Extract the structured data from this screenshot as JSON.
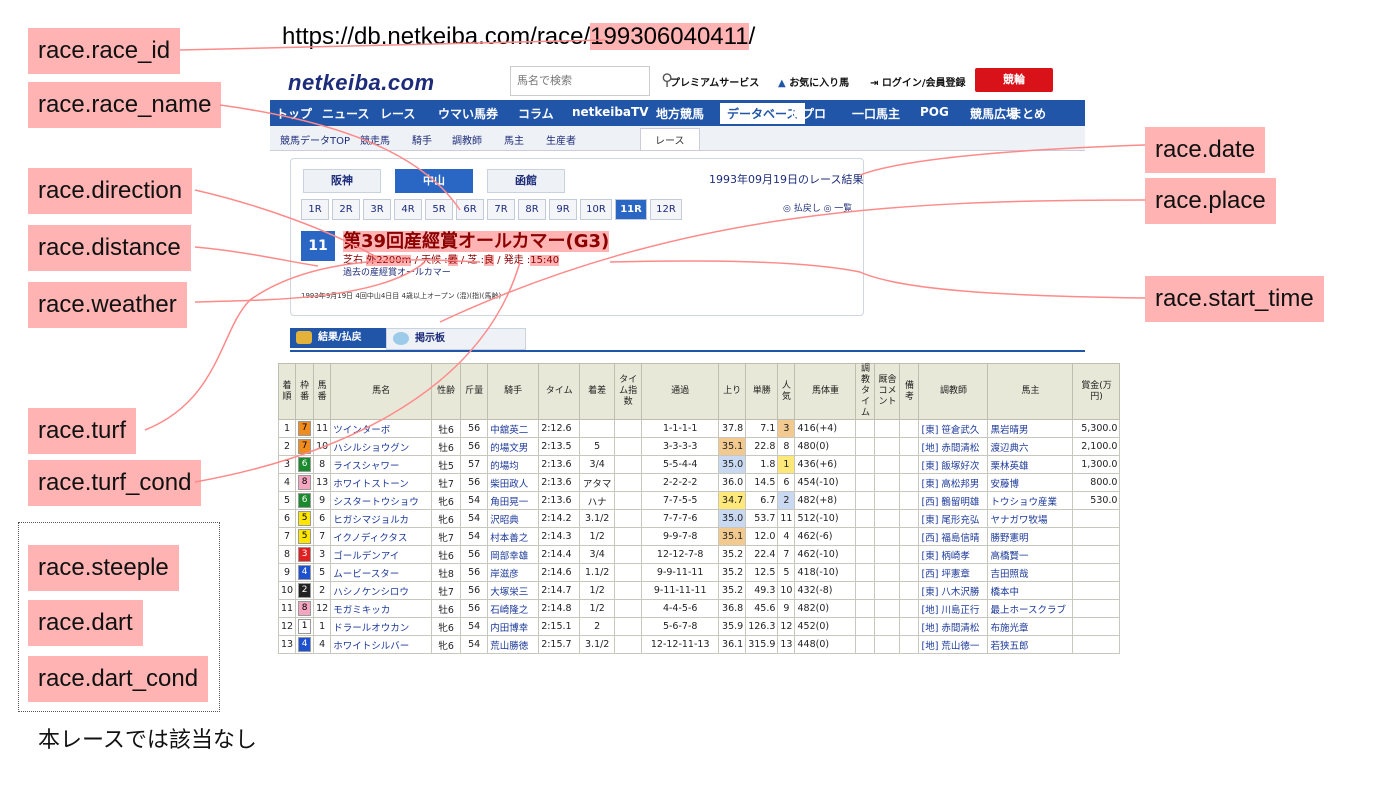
{
  "url": {
    "prefix": "https://db.netkeiba.com/race/",
    "race_id": "199306040411",
    "suffix": "/"
  },
  "annotations": {
    "race_id": "race.race_id",
    "race_name": "race.race_name",
    "direction": "race.direction",
    "distance": "race.distance",
    "weather": "race.weather",
    "turf": "race.turf",
    "turf_cond": "race.turf_cond",
    "steeple": "race.steeple",
    "dart": "race.dart",
    "dart_cond": "race.dart_cond",
    "date": "race.date",
    "place": "race.place",
    "start_time": "race.start_time"
  },
  "note": "本レースでは該当なし",
  "site": {
    "logo": "netkeiba.com",
    "search_placeholder": "馬名で検索",
    "premium": "プレミアムサービス",
    "favorite": "お気に入り馬",
    "login": "ログイン/会員登録",
    "keirin": "競輪",
    "gnav": [
      "トップ",
      "ニュース",
      "レース",
      "ウマい馬券",
      "コラム",
      "netkeibaTV",
      "地方競馬",
      "データベース",
      "俺プロ",
      "一口馬主",
      "POG",
      "競馬広場",
      "まとめ"
    ],
    "gnav_active": 7,
    "subnav": [
      "競馬データTOP",
      "競走馬",
      "騎手",
      "調教師",
      "馬主",
      "生産者",
      "レース"
    ],
    "subnav_active": 6
  },
  "race": {
    "place_tabs": [
      "阪神",
      "中山",
      "函館"
    ],
    "place_active": 1,
    "date_text": "1993年09月19日のレース結果",
    "race_numbers": [
      "1R",
      "2R",
      "3R",
      "4R",
      "5R",
      "6R",
      "7R",
      "8R",
      "9R",
      "10R",
      "11R",
      "12R"
    ],
    "race_active": 10,
    "back_link": "◎ 払戻し ◎ 一覧",
    "badge": "11 R",
    "name": "第39回産經賞オールカマー(G3)",
    "info_surface": "芝右",
    "info_direction": "外",
    "info_distance": "2200m",
    "info_weather_label": "/ 天候 :",
    "info_weather": "曇",
    "info_turf_label": "/ 芝 :",
    "info_turf_cond": "良",
    "info_start_label": "/ 発走 :",
    "info_start": "15:40",
    "past_link": "過去の産經賞オールカマー",
    "detail": "1993年9月19日 4回中山4日目 4歳以上オープン (混)(指)(馬齢)"
  },
  "tabs": [
    "結果/払戻",
    "掲示板"
  ],
  "table": {
    "headers": [
      "着順",
      "枠番",
      "馬番",
      "馬名",
      "性齢",
      "斤量",
      "騎手",
      "タイム",
      "着差",
      "タイム指数",
      "通過",
      "上り",
      "単勝",
      "人気",
      "馬体重",
      "調教タイム",
      "厩舎コメント",
      "備考",
      "調教師",
      "馬主",
      "賞金(万円)"
    ],
    "rows": [
      [
        "1",
        "7",
        "11",
        "ツインターボ",
        "牡6",
        "56",
        "中舘英二",
        "2:12.6",
        "",
        "",
        "1-1-1-1",
        "37.8",
        "7.1",
        "3",
        "416(+4)",
        "",
        "",
        "",
        "[東] 笹倉武久",
        "黒岩晴男",
        "5,300.0"
      ],
      [
        "2",
        "7",
        "10",
        "ハシルショウグン",
        "牡6",
        "56",
        "的場文男",
        "2:13.5",
        "5",
        "",
        "3-3-3-3",
        "35.1",
        "22.8",
        "8",
        "480(0)",
        "",
        "",
        "",
        "[地] 赤間清松",
        "渡辺典六",
        "2,100.0"
      ],
      [
        "3",
        "6",
        "8",
        "ライスシャワー",
        "牡5",
        "57",
        "的場均",
        "2:13.6",
        "3/4",
        "",
        "5-5-4-4",
        "35.0",
        "1.8",
        "1",
        "436(+6)",
        "",
        "",
        "",
        "[東] 飯塚好次",
        "栗林英雄",
        "1,300.0"
      ],
      [
        "4",
        "8",
        "13",
        "ホワイトストーン",
        "牡7",
        "56",
        "柴田政人",
        "2:13.6",
        "アタマ",
        "",
        "2-2-2-2",
        "36.0",
        "14.5",
        "6",
        "454(-10)",
        "",
        "",
        "",
        "[東] 高松邦男",
        "安藤博",
        "800.0"
      ],
      [
        "5",
        "6",
        "9",
        "シスタートウショウ",
        "牝6",
        "54",
        "角田晃一",
        "2:13.6",
        "ハナ",
        "",
        "7-7-5-5",
        "34.7",
        "6.7",
        "2",
        "482(+8)",
        "",
        "",
        "",
        "[西] 鶴留明雄",
        "トウショウ産業",
        "530.0"
      ],
      [
        "6",
        "5",
        "6",
        "ヒガシマジョルカ",
        "牝6",
        "54",
        "沢昭典",
        "2:14.2",
        "3.1/2",
        "",
        "7-7-7-6",
        "35.0",
        "53.7",
        "11",
        "512(-10)",
        "",
        "",
        "",
        "[東] 尾形充弘",
        "ヤナガワ牧場",
        ""
      ],
      [
        "7",
        "5",
        "7",
        "イクノディクタス",
        "牝7",
        "54",
        "村本善之",
        "2:14.3",
        "1/2",
        "",
        "9-9-7-8",
        "35.1",
        "12.0",
        "4",
        "462(-6)",
        "",
        "",
        "",
        "[西] 福島信晴",
        "勝野憲明",
        ""
      ],
      [
        "8",
        "3",
        "3",
        "ゴールデンアイ",
        "牡6",
        "56",
        "岡部幸雄",
        "2:14.4",
        "3/4",
        "",
        "12-12-7-8",
        "35.2",
        "22.4",
        "7",
        "462(-10)",
        "",
        "",
        "",
        "[東] 柄崎孝",
        "高橋賢一",
        ""
      ],
      [
        "9",
        "4",
        "5",
        "ムービースター",
        "牡8",
        "56",
        "岸滋彦",
        "2:14.6",
        "1.1/2",
        "",
        "9-9-11-11",
        "35.2",
        "12.5",
        "5",
        "418(-10)",
        "",
        "",
        "",
        "[西] 坪憲章",
        "吉田照哉",
        ""
      ],
      [
        "10",
        "2",
        "2",
        "ハシノケンシロウ",
        "牡7",
        "56",
        "大塚栄三",
        "2:14.7",
        "1/2",
        "",
        "9-11-11-11",
        "35.2",
        "49.3",
        "10",
        "432(-8)",
        "",
        "",
        "",
        "[東] 八木沢勝",
        "橋本中",
        ""
      ],
      [
        "11",
        "8",
        "12",
        "モガミキッカ",
        "牡6",
        "56",
        "石崎隆之",
        "2:14.8",
        "1/2",
        "",
        "4-4-5-6",
        "36.8",
        "45.6",
        "9",
        "482(0)",
        "",
        "",
        "",
        "[地] 川島正行",
        "最上ホースクラブ",
        ""
      ],
      [
        "12",
        "1",
        "1",
        "ドラールオウカン",
        "牝6",
        "54",
        "内田博幸",
        "2:15.1",
        "2",
        "",
        "5-6-7-8",
        "35.9",
        "126.3",
        "12",
        "452(0)",
        "",
        "",
        "",
        "[地] 赤間清松",
        "布施光章",
        ""
      ],
      [
        "13",
        "4",
        "4",
        "ホワイトシルバー",
        "牝6",
        "54",
        "荒山勝徳",
        "2:15.7",
        "3.1/2",
        "",
        "12-12-11-13",
        "36.1",
        "315.9",
        "13",
        "448(0)",
        "",
        "",
        "",
        "[地] 荒山徳一",
        "若狭五郎",
        ""
      ]
    ]
  }
}
